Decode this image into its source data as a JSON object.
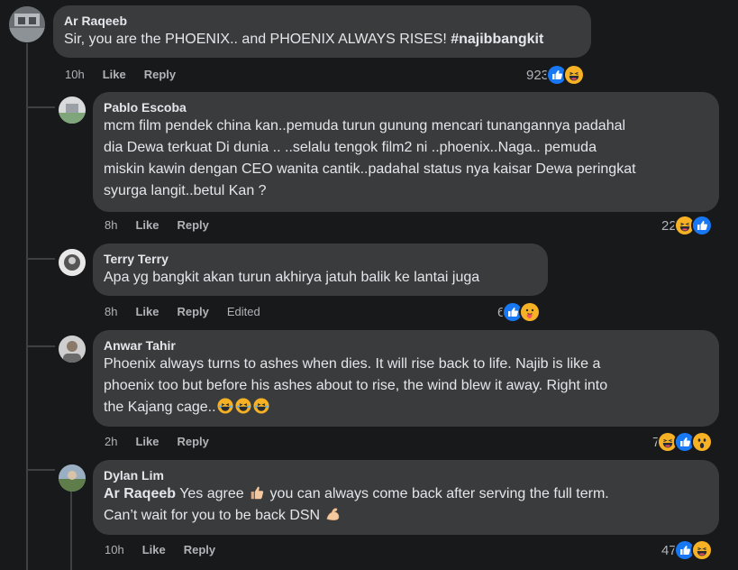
{
  "comments": [
    {
      "author": "Ar Raqeeb",
      "text_parts": [
        "Sir, you are the PHOENIX.. and PHOENIX ALWAYS RISES! ",
        "#najibbangkit"
      ],
      "time": "10h",
      "like_label": "Like",
      "reply_label": "Reply",
      "reaction_count": "923",
      "reactions": [
        "like-icon",
        "haha-icon"
      ]
    },
    {
      "author": "Pablo Escoba",
      "text_lines": [
        "mcm film pendek china kan..pemuda turun gunung mencari tunangannya padahal",
        "dia Dewa terkuat Di dunia .. ..selalu tengok film2 ni ..phoenix..Naga.. pemuda",
        "miskin kawin dengan CEO wanita cantik..padahal status nya kaisar Dewa peringkat",
        "syurga langit..betul Kan ?"
      ],
      "time": "8h",
      "like_label": "Like",
      "reply_label": "Reply",
      "reaction_count": "22",
      "reactions": [
        "haha-icon",
        "like-icon"
      ]
    },
    {
      "author": "Terry Terry",
      "text": "Apa yg bangkit akan turun akhirya jatuh balik ke lantai juga",
      "time": "8h",
      "like_label": "Like",
      "reply_label": "Reply",
      "edited_label": "Edited",
      "reaction_count": "6",
      "reactions": [
        "like-icon",
        "care-icon"
      ]
    },
    {
      "author": "Anwar Tahir",
      "text_lines": [
        "Phoenix always turns to ashes when dies. It will rise back to life. Najib is like a",
        "phoenix too but before his ashes about to rise, the wind blew it away. Right into",
        "the Kajang cage.."
      ],
      "time": "2h",
      "like_label": "Like",
      "reply_label": "Reply",
      "reaction_count": "7",
      "reactions": [
        "haha-icon",
        "like-icon",
        "wow-icon"
      ]
    },
    {
      "author": "Dylan Lim",
      "mention": "Ar Raqeeb",
      "line1_text": " Yes agree ",
      "line1_rest": " you can always come back after serving the full term.",
      "line2_text": "Can’t wait for you to be back DSN ",
      "time": "10h",
      "like_label": "Like",
      "reply_label": "Reply",
      "reaction_count": "47",
      "reactions": [
        "like-icon",
        "haha-icon"
      ]
    }
  ],
  "colors": {
    "background": "#18191a",
    "bubble": "#3a3b3c",
    "text": "#e4e6eb",
    "secondary_text": "#b0b3b8",
    "like_blue": "#1877f2",
    "haha_yellow": "#f7b125"
  }
}
